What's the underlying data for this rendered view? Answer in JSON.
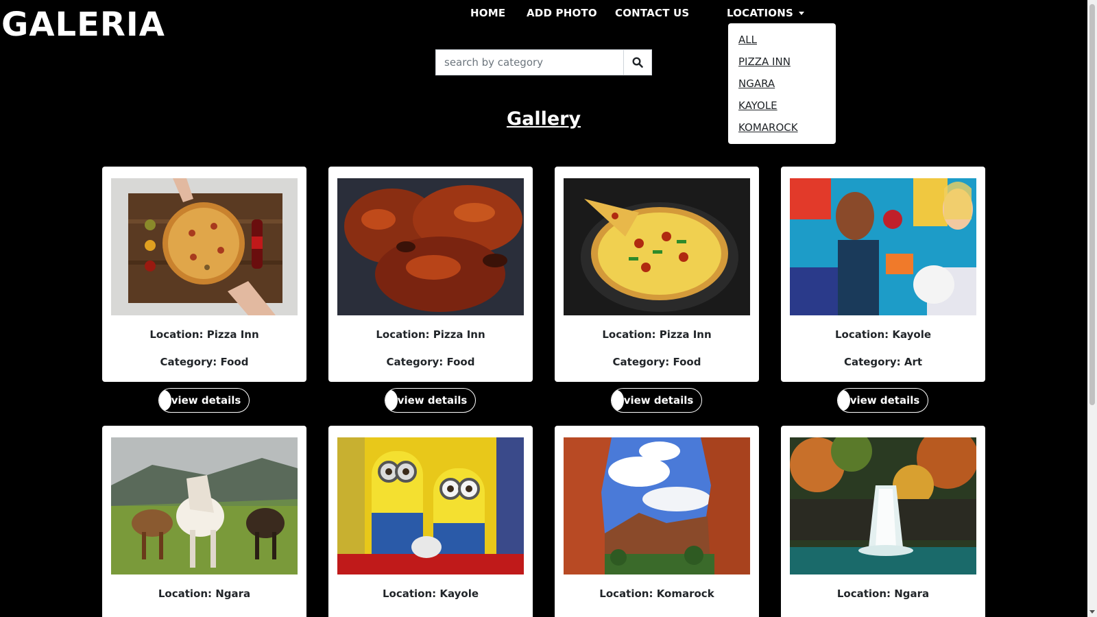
{
  "brand": "GALERIA",
  "nav": {
    "home": "HOME",
    "add_photo": "ADD PHOTO",
    "contact": "CONTACT US",
    "locations": "LOCATIONS"
  },
  "locations_menu": [
    "ALL",
    "PIZZA INN",
    "NGARA",
    "KAYOLE",
    "KOMAROCK"
  ],
  "search": {
    "placeholder": "search by category"
  },
  "gallery_title": "Gallery",
  "cards": [
    {
      "location": "Location: Pizza Inn",
      "category": "Category: Food",
      "image": "pizza-board-photo"
    },
    {
      "location": "Location: Pizza Inn",
      "category": "Category: Food",
      "image": "grilled-chicken-photo"
    },
    {
      "location": "Location: Pizza Inn",
      "category": "Category: Food",
      "image": "pizza-pan-photo"
    },
    {
      "location": "Location: Kayole",
      "category": "Category: Art",
      "image": "street-art-mural-photo"
    },
    {
      "location": "Location: Ngara",
      "category": "",
      "image": "horses-photo"
    },
    {
      "location": "Location: Kayole",
      "category": "",
      "image": "minions-photo"
    },
    {
      "location": "Location: Komarock",
      "category": "",
      "image": "canyon-photo"
    },
    {
      "location": "Location: Ngara",
      "category": "",
      "image": "waterfall-photo"
    }
  ],
  "view_details_label": "view details"
}
